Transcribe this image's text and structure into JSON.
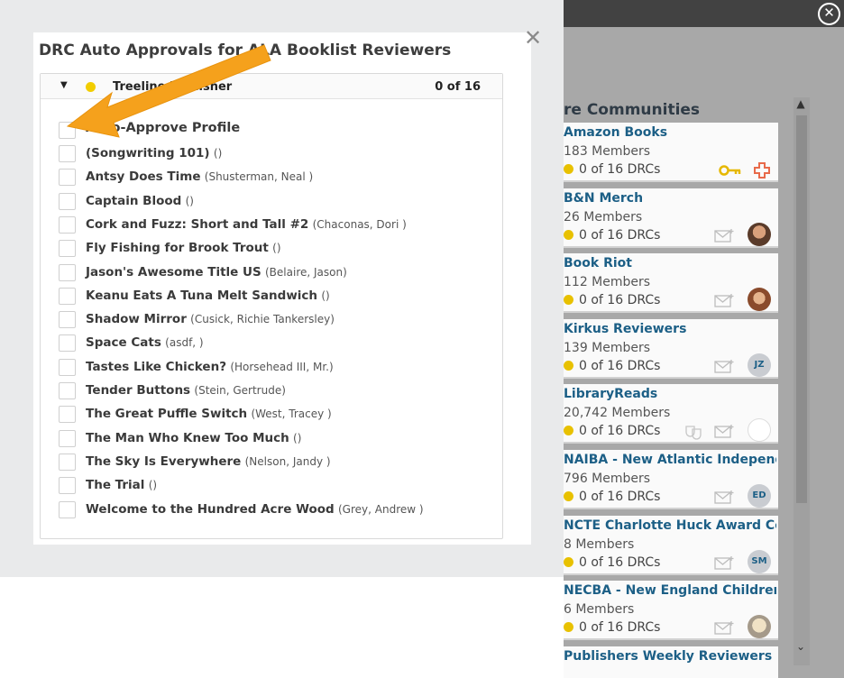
{
  "modal": {
    "title": "DRC Auto Approvals for ALA Booklist Reviewers",
    "publisher": "Treeline Publisher",
    "count": "0 of 16",
    "auto_approve_label": "Auto-Approve Profile",
    "books": [
      {
        "title": "(Songwriting 101)",
        "author": "()"
      },
      {
        "title": "Antsy Does Time",
        "author": "(Shusterman, Neal )"
      },
      {
        "title": "Captain Blood",
        "author": "()"
      },
      {
        "title": "Cork and Fuzz: Short and Tall #2",
        "author": "(Chaconas, Dori )"
      },
      {
        "title": "Fly Fishing for Brook Trout",
        "author": "()"
      },
      {
        "title": "Jason's Awesome Title US",
        "author": "(Belaire, Jason)"
      },
      {
        "title": "Keanu Eats A Tuna Melt Sandwich",
        "author": "()"
      },
      {
        "title": "Shadow Mirror",
        "author": "(Cusick, Richie Tankersley)"
      },
      {
        "title": "Space Cats",
        "author": "(asdf, )"
      },
      {
        "title": "Tastes Like Chicken?",
        "author": "(Horsehead III, Mr.)"
      },
      {
        "title": "Tender Buttons",
        "author": "(Stein, Gertrude)"
      },
      {
        "title": "The Great Puffle Switch",
        "author": "(West, Tracey )"
      },
      {
        "title": "The Man Who Knew Too Much",
        "author": "()"
      },
      {
        "title": "The Sky Is Everywhere",
        "author": "(Nelson, Jandy )"
      },
      {
        "title": "The Trial",
        "author": "()"
      },
      {
        "title": "Welcome to the Hundred Acre Wood",
        "author": "(Grey, Andrew )"
      }
    ]
  },
  "communities": {
    "title": "re Communities",
    "items": [
      {
        "name": "Amazon Books",
        "members": "183 Members",
        "drcs": "0 of 16 DRCs",
        "avatar": ""
      },
      {
        "name": "B&N Merch",
        "members": "26 Members",
        "drcs": "0 of 16 DRCs",
        "avatar": ""
      },
      {
        "name": "Book Riot",
        "members": "112 Members",
        "drcs": "0 of 16 DRCs",
        "avatar": ""
      },
      {
        "name": "Kirkus Reviewers",
        "members": "139 Members",
        "drcs": "0 of 16 DRCs",
        "avatar": "JZ"
      },
      {
        "name": "LibraryReads",
        "members": "20,742 Members",
        "drcs": "0 of 16 DRCs",
        "avatar": ""
      },
      {
        "name": "NAIBA - New Atlantic Independ...",
        "members": "796 Members",
        "drcs": "0 of 16 DRCs",
        "avatar": "ED"
      },
      {
        "name": "NCTE Charlotte Huck Award Co...",
        "members": "8 Members",
        "drcs": "0 of 16 DRCs",
        "avatar": "SM"
      },
      {
        "name": "NECBA - New England Children's...",
        "members": "6 Members",
        "drcs": "0 of 16 DRCs",
        "avatar": ""
      },
      {
        "name": "Publishers Weekly Reviewers",
        "members": "",
        "drcs": "",
        "avatar": ""
      }
    ]
  },
  "colors": {
    "link": "#1c5f86",
    "status_dot": "#f2cd00",
    "arrow": "#f5a11c"
  },
  "icons": {
    "close": "close-icon",
    "close_circle": "close-circle-icon",
    "caret": "caret-down-icon",
    "mail": "mail-icon",
    "key": "key-icon",
    "plus": "plus-icon"
  }
}
